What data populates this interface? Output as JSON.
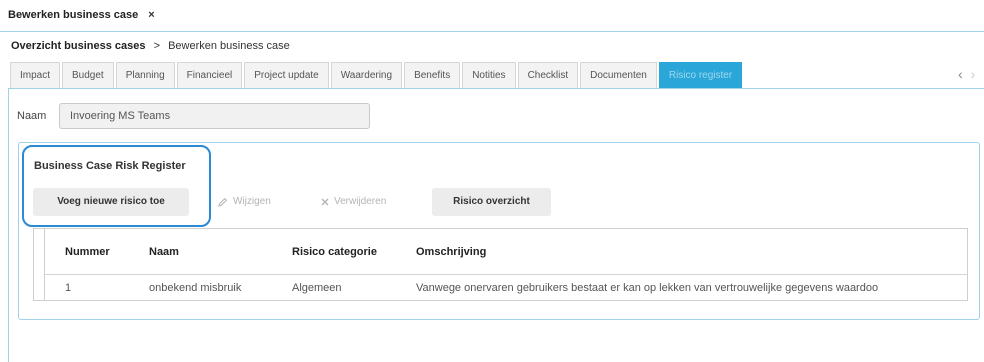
{
  "doc_tab": {
    "title": "Bewerken business case",
    "close": "×"
  },
  "breadcrumb": {
    "root": "Overzicht business cases",
    "separator": ">",
    "current": "Bewerken business case"
  },
  "tabs": [
    {
      "label": "Impact"
    },
    {
      "label": "Budget"
    },
    {
      "label": "Planning"
    },
    {
      "label": "Financieel"
    },
    {
      "label": "Project update"
    },
    {
      "label": "Waardering"
    },
    {
      "label": "Benefits"
    },
    {
      "label": "Notities"
    },
    {
      "label": "Checklist"
    },
    {
      "label": "Documenten"
    },
    {
      "label": "Risico register"
    }
  ],
  "tab_nav": {
    "prev": "‹",
    "next": "›"
  },
  "form": {
    "naam_label": "Naam",
    "naam_value": "Invoering MS Teams"
  },
  "risk_register": {
    "title": "Business Case Risk Register",
    "add_button": "Voeg nieuwe risico toe",
    "edit_button": "Wijzigen",
    "delete_button": "Verwijderen",
    "overview_button": "Risico overzicht",
    "columns": [
      "Nummer",
      "Naam",
      "Risico categorie",
      "Omschrijving"
    ],
    "rows": [
      {
        "nummer": "1",
        "naam": "onbekend misbruik",
        "categorie": "Algemeen",
        "omschrijving": "Vanwege onervaren gebruikers bestaat er kan op lekken van vertrouwelijke gegevens waardoo"
      }
    ]
  },
  "colors": {
    "accent": "#2aa6d8",
    "highlight": "#2a8ad4",
    "border": "#9fd2ea"
  }
}
